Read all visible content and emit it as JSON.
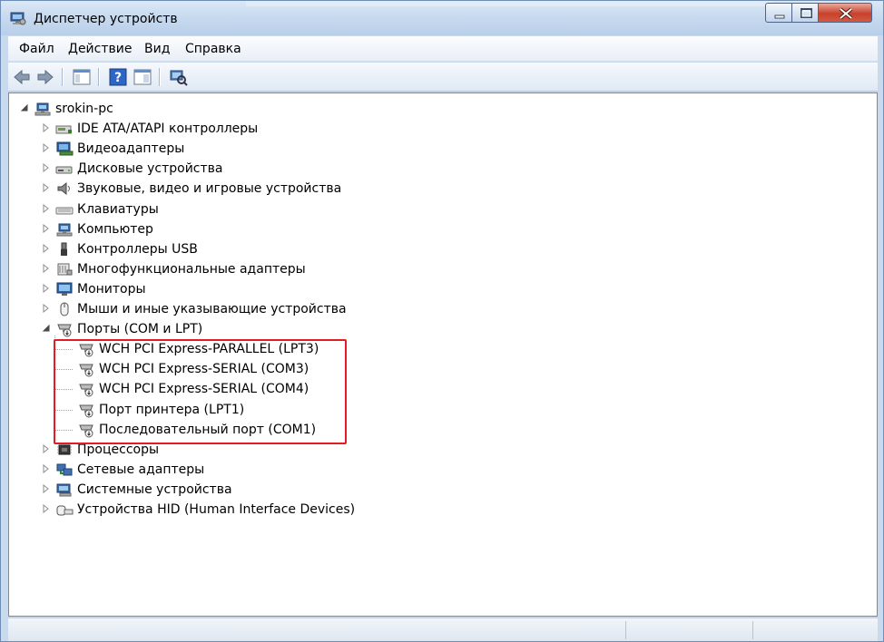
{
  "window": {
    "title": "Диспетчер устройств",
    "title_icon": "device-manager-icon",
    "buttons": [
      "minimize",
      "maximize",
      "close"
    ]
  },
  "menu": [
    "Файл",
    "Действие",
    "Вид",
    "Справка"
  ],
  "toolbar": {
    "buttons": [
      "back-arrow-icon",
      "forward-arrow-icon",
      "show-hide-console-tree-icon",
      "help-icon",
      "properties-icon",
      "scan-hardware-icon"
    ]
  },
  "tree": {
    "root": {
      "label": "srokin-pc",
      "icon": "computer-icon",
      "expanded": true
    },
    "categories": [
      {
        "label": "IDE ATA/ATAPI контроллеры",
        "icon": "ide-controller-icon",
        "expanded": false
      },
      {
        "label": "Видеоадаптеры",
        "icon": "display-adapter-icon",
        "expanded": false
      },
      {
        "label": "Дисковые устройства",
        "icon": "disk-drive-icon",
        "expanded": false
      },
      {
        "label": "Звуковые, видео и игровые устройства",
        "icon": "speaker-icon",
        "expanded": false
      },
      {
        "label": "Клавиатуры",
        "icon": "keyboard-icon",
        "expanded": false
      },
      {
        "label": "Компьютер",
        "icon": "computer-icon",
        "expanded": false
      },
      {
        "label": "Контроллеры USB",
        "icon": "usb-icon",
        "expanded": false
      },
      {
        "label": "Многофункциональные адаптеры",
        "icon": "multifunction-adapter-icon",
        "expanded": false
      },
      {
        "label": "Мониторы",
        "icon": "monitor-icon",
        "expanded": false
      },
      {
        "label": "Мыши и иные указывающие устройства",
        "icon": "mouse-icon",
        "expanded": false
      },
      {
        "label": "Порты (COM и LPT)",
        "icon": "port-icon",
        "expanded": true,
        "children": [
          {
            "label": "WCH PCI Express-PARALLEL (LPT3)",
            "icon": "port-icon"
          },
          {
            "label": "WCH PCI Express-SERIAL (COM3)",
            "icon": "port-icon"
          },
          {
            "label": "WCH PCI Express-SERIAL (COM4)",
            "icon": "port-icon"
          },
          {
            "label": "Порт принтера (LPT1)",
            "icon": "port-icon"
          },
          {
            "label": "Последовательный порт (COM1)",
            "icon": "port-icon"
          }
        ]
      },
      {
        "label": "Процессоры",
        "icon": "processor-icon",
        "expanded": false
      },
      {
        "label": "Сетевые адаптеры",
        "icon": "network-adapter-icon",
        "expanded": false
      },
      {
        "label": "Системные устройства",
        "icon": "system-device-icon",
        "expanded": false
      },
      {
        "label": "Устройства HID (Human Interface Devices)",
        "icon": "hid-icon",
        "expanded": false
      }
    ]
  },
  "annotation": {
    "color": "#e21c22"
  },
  "colors": {
    "title_bar": "#c6d9ef",
    "close_button": "#c7412c"
  }
}
